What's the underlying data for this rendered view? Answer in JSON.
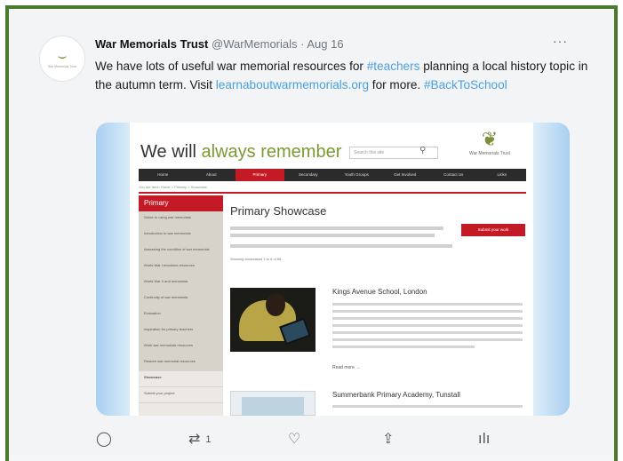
{
  "tweet": {
    "author_name": "War Memorials Trust",
    "handle": "@WarMemorials",
    "separator": " · ",
    "date": "Aug 16",
    "more": "···",
    "text_1": "We have lots of useful war memorial resources for ",
    "hashtag_teachers": "#teachers",
    "text_2": " planning a local history topic in the autumn term. Visit ",
    "link": "learnaboutwarmemorials.org",
    "text_3": " for more. ",
    "hashtag_backtoschool": "#BackToSchool",
    "avatar_org": "War Memorials Trust"
  },
  "site": {
    "title_1": "We will ",
    "title_2": "always remember",
    "search_placeholder": "Search this site",
    "logo_org": "War Memorials Trust",
    "nav": [
      "Home",
      "About",
      "Primary",
      "Secondary",
      "Youth Groups",
      "Get Involved",
      "Contact Us",
      "Links"
    ],
    "active_nav": 2,
    "breadcrumb": "You are here: Home > Primary > Showcase",
    "sidebar_head": "Primary",
    "sidebar_items": [
      "Guide to using war memorials",
      "Introduction to war memorials",
      "Assessing the condition of war memorials",
      "World War I emotions resources",
      "World War II and memorials",
      "Continuity of war memorials",
      "Evaluation",
      "Inspiration for primary teachers",
      "Work war memorials resources",
      "Restore war memorial resources",
      "Showcase",
      "Submit your project"
    ],
    "showcase_title": "Primary Showcase",
    "submit_button": "Submit your work",
    "showing": "Showing showcases 1 to 6 of 88",
    "entries": [
      {
        "title": "Kings Avenue School, London",
        "readmore": "Read more →"
      },
      {
        "title": "Summerbank Primary Academy, Tunstall"
      }
    ]
  },
  "actions": {
    "reply_icon": "reply-icon",
    "retweet_icon": "retweet-icon",
    "retweet_count": "1",
    "like_icon": "heart-icon",
    "share_icon": "share-icon",
    "analytics_icon": "analytics-icon"
  },
  "colors": {
    "frame_border": "#4a7a2e",
    "link_blue": "#4aa0e0",
    "site_red": "#c41a26",
    "site_green": "#7a9a34"
  }
}
